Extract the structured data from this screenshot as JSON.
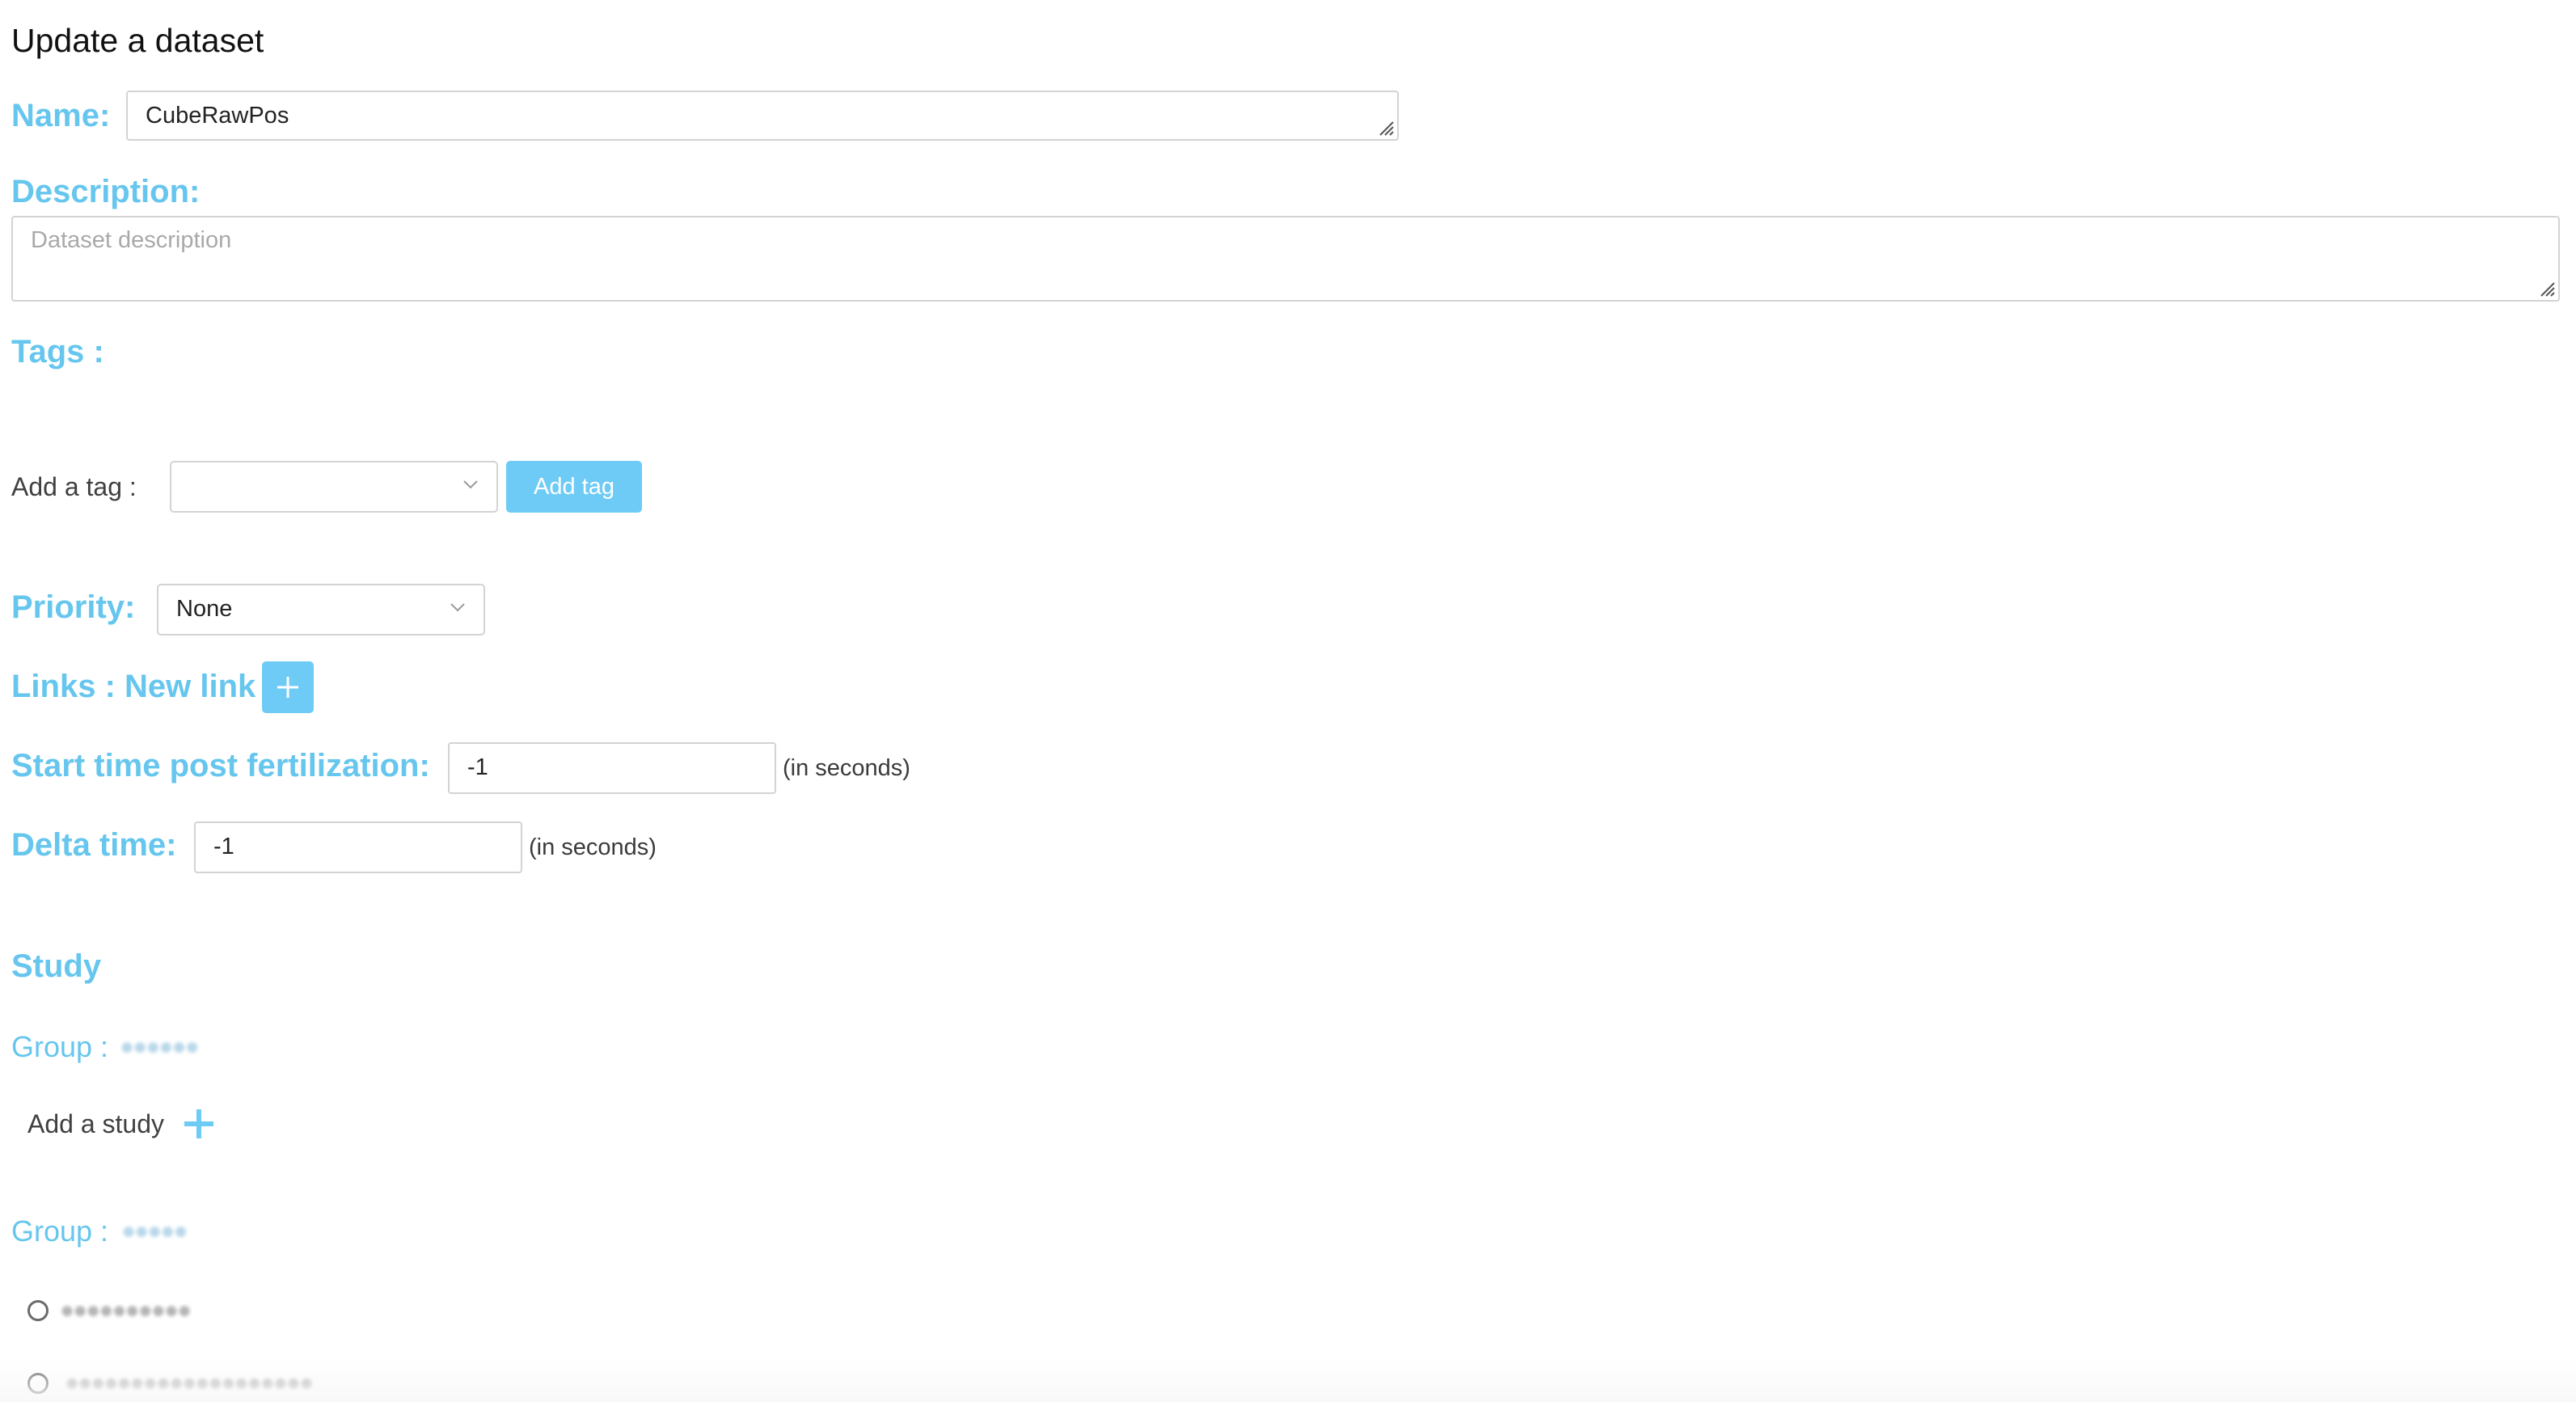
{
  "page": {
    "title": "Update a dataset"
  },
  "form": {
    "name": {
      "label": "Name:",
      "value": "CubeRawPos"
    },
    "description": {
      "label": "Description:",
      "value": "",
      "placeholder": "Dataset description"
    },
    "tags": {
      "label": "Tags :",
      "add_label": "Add a tag :",
      "selected": "",
      "add_button": "Add tag"
    },
    "priority": {
      "label": "Priority:",
      "selected": "None"
    },
    "links": {
      "label": "Links : New link",
      "add_icon": "plus-icon"
    },
    "start_time": {
      "label": "Start time post fertilization:",
      "value": "-1",
      "unit": "(in seconds)"
    },
    "delta_time": {
      "label": "Delta time:",
      "value": "-1",
      "unit": "(in seconds)"
    }
  },
  "study": {
    "heading": "Study",
    "groups": [
      {
        "label": "Group :",
        "name_redacted": "●●●●●●",
        "add_study_label": "Add a study",
        "add_icon": "plus-icon"
      },
      {
        "label": "Group :",
        "name_redacted": "●●●●●",
        "studies": [
          {
            "name_redacted": "●●●●●●●●●●",
            "selected": false
          },
          {
            "name_redacted": "●●●●●●●●●●●●●●●●●●●",
            "selected": false
          }
        ]
      }
    ]
  },
  "colors": {
    "label_blue": "#66c6ee",
    "button_blue": "#6ecbf5",
    "border_gray": "#d3d3d3"
  }
}
